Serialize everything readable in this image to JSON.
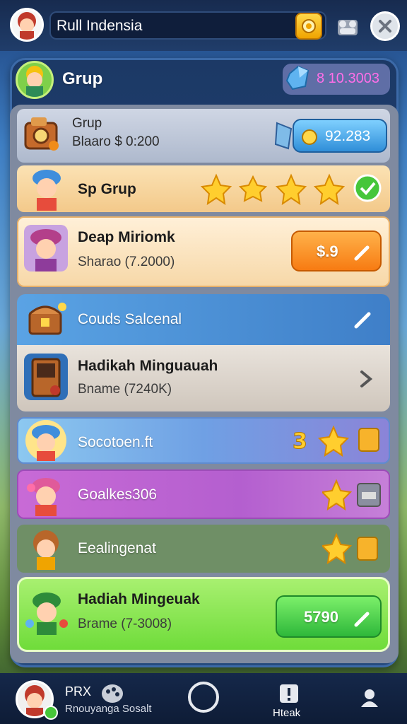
{
  "header": {
    "search_text": "Rull Indensia"
  },
  "group": {
    "title": "Grup",
    "gem_value": "8 10.3003"
  },
  "card_top": {
    "title": "Grup",
    "subtitle": "Blaaro $ 0:200",
    "coin_value": "92.283"
  },
  "rows": [
    {
      "title": "Sp Grup"
    },
    {
      "title": "Deap Miriomk",
      "subtitle": "Sharao (7.2000)",
      "button": "$.9"
    },
    {
      "title": "Couds Salcenal"
    },
    {
      "title": "Hadikah Minguauah",
      "subtitle": "Bname (7240K)"
    },
    {
      "title": "Socotoen.ft"
    },
    {
      "title": "Goalkes306"
    },
    {
      "title": "Eealingenat"
    },
    {
      "title": "Hadiah Mingeuak",
      "subtitle": "Brame (7-3008)",
      "button": "5790"
    }
  ],
  "bottom_nav": {
    "name": "PRX",
    "subtitle": "Rnouyanga Sosalt",
    "item_label": "Hteak"
  },
  "colors": {
    "accent_orange": "#f7901e",
    "accent_green": "#46c63a",
    "row_blue": "#4b8fd8",
    "row_purple": "#b05fcd"
  }
}
